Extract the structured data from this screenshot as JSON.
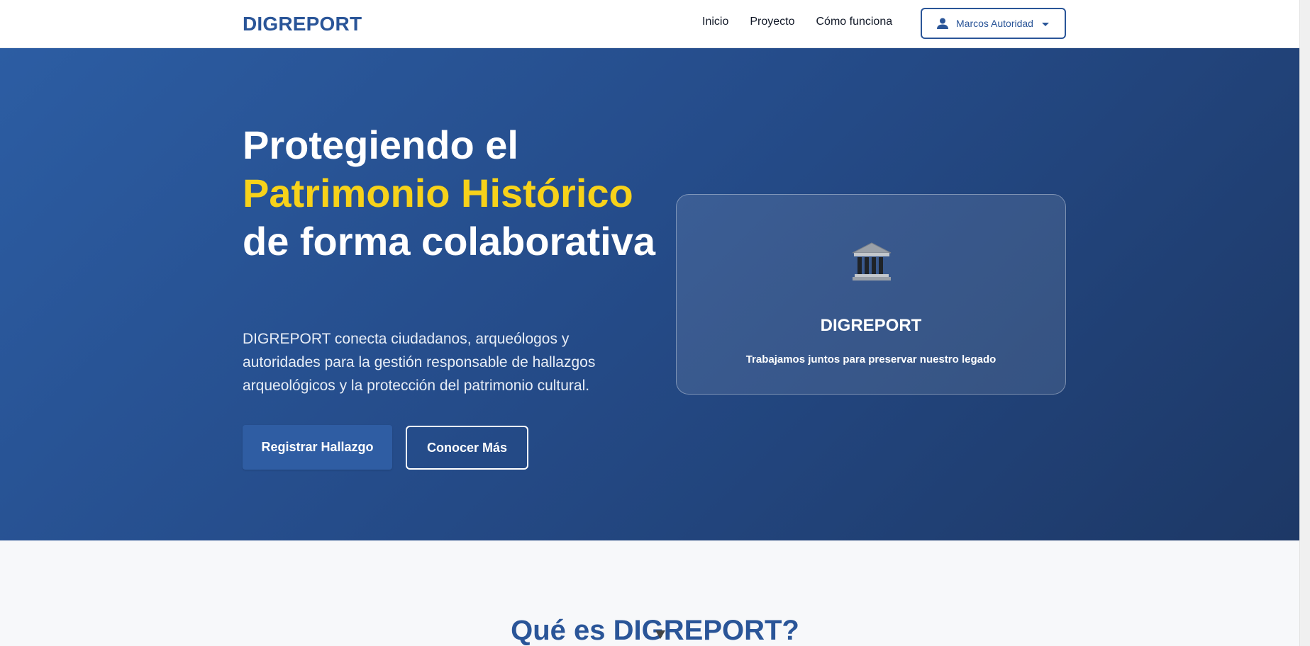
{
  "header": {
    "brand": "DIGREPORT",
    "nav": [
      {
        "label": "Inicio"
      },
      {
        "label": "Proyecto"
      },
      {
        "label": "Cómo funciona"
      }
    ],
    "user": {
      "name": "Marcos Autoridad",
      "icon": "user-icon"
    }
  },
  "hero": {
    "title_line1": "Protegiendo el",
    "title_accent": "Patrimonio Histórico",
    "title_line3": "de forma colaborativa",
    "description": "DIGREPORT conecta ciudadanos, arqueólogos y autoridades para la gestión responsable de hallazgos arqueológicos y la protección del patrimonio cultural.",
    "primary_button": "Registrar Hallazgo",
    "secondary_button": "Conocer Más",
    "card": {
      "icon": "classical-building-icon",
      "title": "DIGREPORT",
      "subtitle": "Trabajamos juntos para preservar nuestro legado"
    }
  },
  "section": {
    "title": "Qué es DIGREPORT?"
  },
  "colors": {
    "brand": "#2a5598",
    "accent": "#f7d21a",
    "hero_start": "#2c5da3",
    "hero_end": "#1d3866"
  }
}
